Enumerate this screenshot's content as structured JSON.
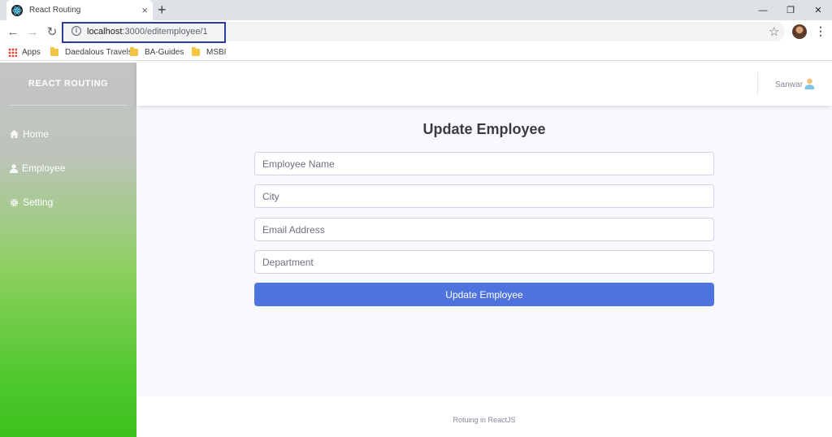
{
  "browser": {
    "tab_title": "React Routing",
    "tab_close": "×",
    "new_tab": "+",
    "window_controls": {
      "minimize": "—",
      "restore": "❐",
      "close": "✕"
    },
    "nav": {
      "back": "←",
      "forward": "→",
      "reload": "↻"
    },
    "url_host": "localhost",
    "url_path": ":3000/editemployee/1",
    "bookmarks": [
      "Apps",
      "Daedalous Travels",
      "BA-Guides",
      "MSBI"
    ]
  },
  "sidebar": {
    "brand": "REACT ROUTING",
    "items": [
      {
        "label": "Home",
        "icon": "home-icon"
      },
      {
        "label": "Employee",
        "icon": "user-icon"
      },
      {
        "label": "Setting",
        "icon": "gear-icon"
      }
    ]
  },
  "topbar": {
    "user_name": "Sanwar"
  },
  "form": {
    "title": "Update Employee",
    "fields": [
      {
        "placeholder": "Employee Name",
        "value": ""
      },
      {
        "placeholder": "City",
        "value": ""
      },
      {
        "placeholder": "Email Address",
        "value": ""
      },
      {
        "placeholder": "Department",
        "value": ""
      }
    ],
    "submit_label": "Update Employee"
  },
  "footer": {
    "text": "Rotuing in ReactJS"
  },
  "colors": {
    "accent": "#4e73df",
    "url_highlight": "#2e3a9e",
    "sidebar_bottom": "#3cc21e"
  }
}
